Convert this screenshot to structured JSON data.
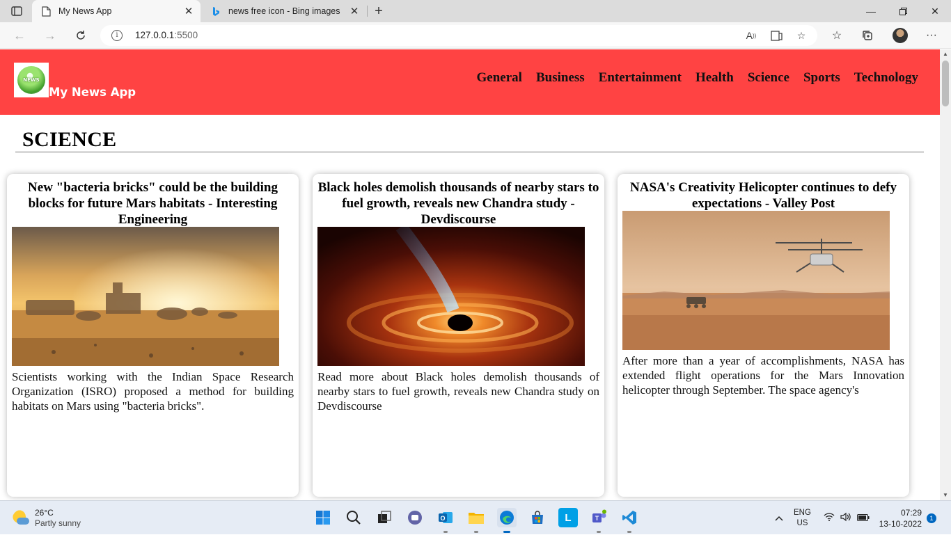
{
  "browser": {
    "tabs": [
      {
        "title": "My News App",
        "active": true
      },
      {
        "title": "news free icon - Bing images",
        "active": false
      }
    ],
    "url_host": "127.0.0.1",
    "url_port": ":5500",
    "icons": {
      "tab_actions": "tab-actions-icon",
      "back": "back-arrow-icon",
      "forward": "forward-arrow-icon",
      "refresh": "refresh-icon",
      "site_info": "info-icon",
      "read_aloud": "read-aloud-icon",
      "immersive_reader": "immersive-reader-icon",
      "add_favorite": "add-favorite-icon",
      "favorites": "favorites-icon",
      "collections": "collections-icon",
      "profile": "profile-avatar",
      "menu": "more-menu-icon"
    }
  },
  "site": {
    "brand": "My News App",
    "logo_text": "NEWS",
    "nav": [
      "General",
      "Business",
      "Entertainment",
      "Health",
      "Science",
      "Sports",
      "Technology"
    ],
    "section_title": "SCIENCE",
    "header_color": "#ff4343"
  },
  "articles": [
    {
      "title": "New \"bacteria bricks\" could be the building blocks for future Mars habitats - Interesting Engineering",
      "image": "mars-habitat-image",
      "description": "Scientists working with the Indian Space Research Organization (ISRO) proposed a method for building habitats on Mars using \"bacteria bricks\"."
    },
    {
      "title": "Black holes demolish thousands of nearby stars to fuel growth, reveals new Chandra study - Devdiscourse",
      "image": "black-hole-image",
      "description": "Read more about Black holes demolish thousands of nearby stars to fuel growth, reveals new Chandra study on Devdiscourse"
    },
    {
      "title": "NASA's Creativity Helicopter continues to defy expectations - Valley Post",
      "image": "mars-helicopter-image",
      "description": "After more than a year of accomplishments, NASA has extended flight operations for the Mars Innovation helicopter through September. The space agency's"
    }
  ],
  "taskbar": {
    "weather_temp": "26°C",
    "weather_cond": "Partly sunny",
    "lang_top": "ENG",
    "lang_bottom": "US",
    "time": "07:29",
    "date": "13-10-2022",
    "notifications": "1",
    "apps": [
      "windows-start-icon",
      "search-icon",
      "task-view-icon",
      "chat-icon",
      "outlook-icon",
      "file-explorer-icon",
      "edge-icon",
      "store-icon",
      "l-app-icon",
      "teams-icon",
      "vscode-icon"
    ]
  }
}
